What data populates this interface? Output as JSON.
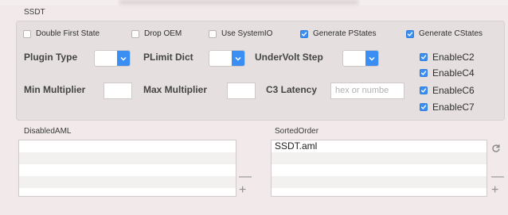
{
  "group": {
    "title": "SSDT"
  },
  "checkboxes": [
    {
      "label": "Double First State",
      "checked": false
    },
    {
      "label": "Drop OEM",
      "checked": false
    },
    {
      "label": "Use SystemIO",
      "checked": false
    },
    {
      "label": "Generate PStates",
      "checked": true
    },
    {
      "label": "Generate CStates",
      "checked": true
    }
  ],
  "fields": {
    "plugin_type": {
      "label": "Plugin Type",
      "value": ""
    },
    "plimit_dict": {
      "label": "PLimit Dict",
      "value": ""
    },
    "undervolt_step": {
      "label": "UnderVolt Step",
      "value": ""
    },
    "min_multiplier": {
      "label": "Min Multiplier",
      "value": ""
    },
    "max_multiplier": {
      "label": "Max Multiplier",
      "value": ""
    },
    "c3_latency": {
      "label": "C3 Latency",
      "placeholder": "hex or numbe"
    }
  },
  "enable_checks": [
    {
      "label": "EnableC2",
      "checked": true
    },
    {
      "label": "EnableC4",
      "checked": true
    },
    {
      "label": "EnableC6",
      "checked": true
    },
    {
      "label": "EnableC7",
      "checked": true
    }
  ],
  "disabled_aml": {
    "title": "DisabledAML",
    "items": []
  },
  "sorted_order": {
    "title": "SortedOrder",
    "items": [
      "SSDT.aml"
    ]
  },
  "list_controls": {
    "minus": "—",
    "plus": "+"
  },
  "colors": {
    "accent": "#3b8ff3",
    "background": "#f1e9ea",
    "group_bg": "#e6dfe0"
  },
  "icons": {
    "check": "checkmark-icon",
    "dropdown": "chevron-down-icon",
    "refresh": "refresh-icon"
  }
}
